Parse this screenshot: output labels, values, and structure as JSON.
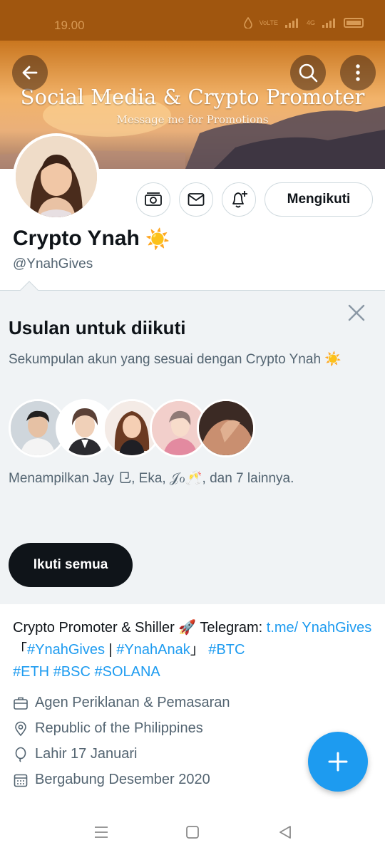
{
  "status_bar": {
    "time": "19.00",
    "network_label": "4G",
    "volte_label": "VoLTE"
  },
  "banner": {
    "title": "Social Media & Crypto Promoter",
    "subtitle": "Message me for Promotions"
  },
  "profile": {
    "name": "Crypto Ynah",
    "name_emoji": "☀️",
    "handle": "@YnahGives",
    "follow_label": "Mengikuti"
  },
  "suggestions": {
    "title": "Usulan untuk diikuti",
    "description": "Sekumpulan akun yang sesuai dengan Crypto Ynah ☀️",
    "showing": "Menampilkan Jay ⺋, Eka, 𝒥ℴ🥂, dan 7 lainnya.",
    "follow_all_label": "Ikuti semua"
  },
  "bio": {
    "text_1": "Crypto Promoter & Shiller 🚀 Telegram: ",
    "link_telegram": "t.me/ YnahGives",
    "bracket_open": " 「",
    "tag_1": "#YnahGives",
    "sep": " | ",
    "tag_2": "#YnahAnak",
    "bracket_close": "」 ",
    "tag_3": "#BTC",
    "tag_4": "#ETH",
    "tag_5": "#BSC",
    "tag_6": "#SOLANA"
  },
  "meta": {
    "category": "Agen Periklanan & Pemasaran",
    "location": "Republic of the Philippines",
    "birthday": "Lahir 17 Januari",
    "joined": "Bergabung Desember 2020"
  },
  "colors": {
    "accent": "#1d9bf0",
    "status_bar": "#a0560f",
    "primary_button": "#0f1419",
    "secondary_text": "#536471"
  }
}
